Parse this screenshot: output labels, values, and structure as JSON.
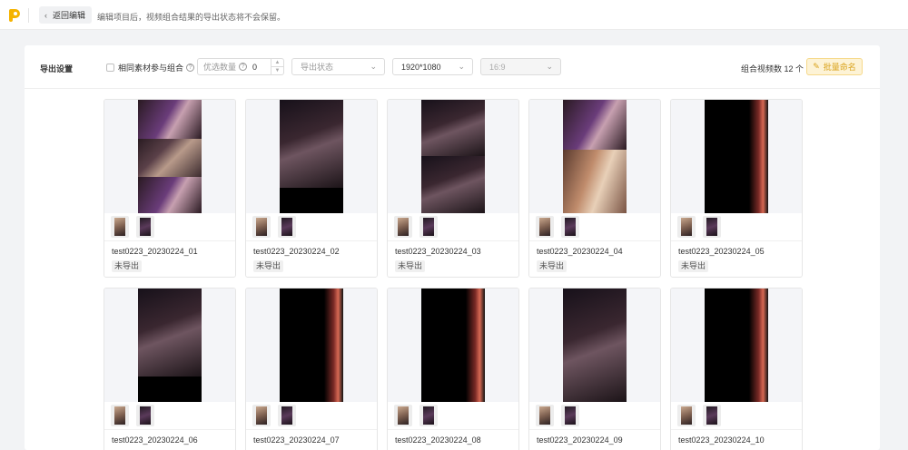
{
  "topbar": {
    "back_label": "返回编辑",
    "tip": "编辑项目后，视频组合结果的导出状态将不会保留。"
  },
  "toolbar": {
    "title": "导出设置",
    "same_material_label": "相同素材参与组合",
    "same_material_checked": false,
    "preferred_count_label": "优选数量",
    "preferred_count_value": "0",
    "export_status_placeholder": "导出状态",
    "resolution": "1920*1080",
    "ratio": "16:9",
    "combo_count_text": "组合视频数 12 个",
    "batch_rename_label": "批量命名"
  },
  "cards": [
    {
      "name": "test0223_20230224_01",
      "status": "未导出"
    },
    {
      "name": "test0223_20230224_02",
      "status": "未导出"
    },
    {
      "name": "test0223_20230224_03",
      "status": "未导出"
    },
    {
      "name": "test0223_20230224_04",
      "status": "未导出"
    },
    {
      "name": "test0223_20230224_05",
      "status": "未导出"
    },
    {
      "name": "test0223_20230224_06",
      "status": ""
    },
    {
      "name": "test0223_20230224_07",
      "status": ""
    },
    {
      "name": "test0223_20230224_08",
      "status": ""
    },
    {
      "name": "test0223_20230224_09",
      "status": ""
    },
    {
      "name": "test0223_20230224_10",
      "status": ""
    }
  ],
  "colors": {
    "accent": "#f5b300",
    "rename_bg": "#fdf3d6",
    "rename_text": "#d9a21b"
  }
}
